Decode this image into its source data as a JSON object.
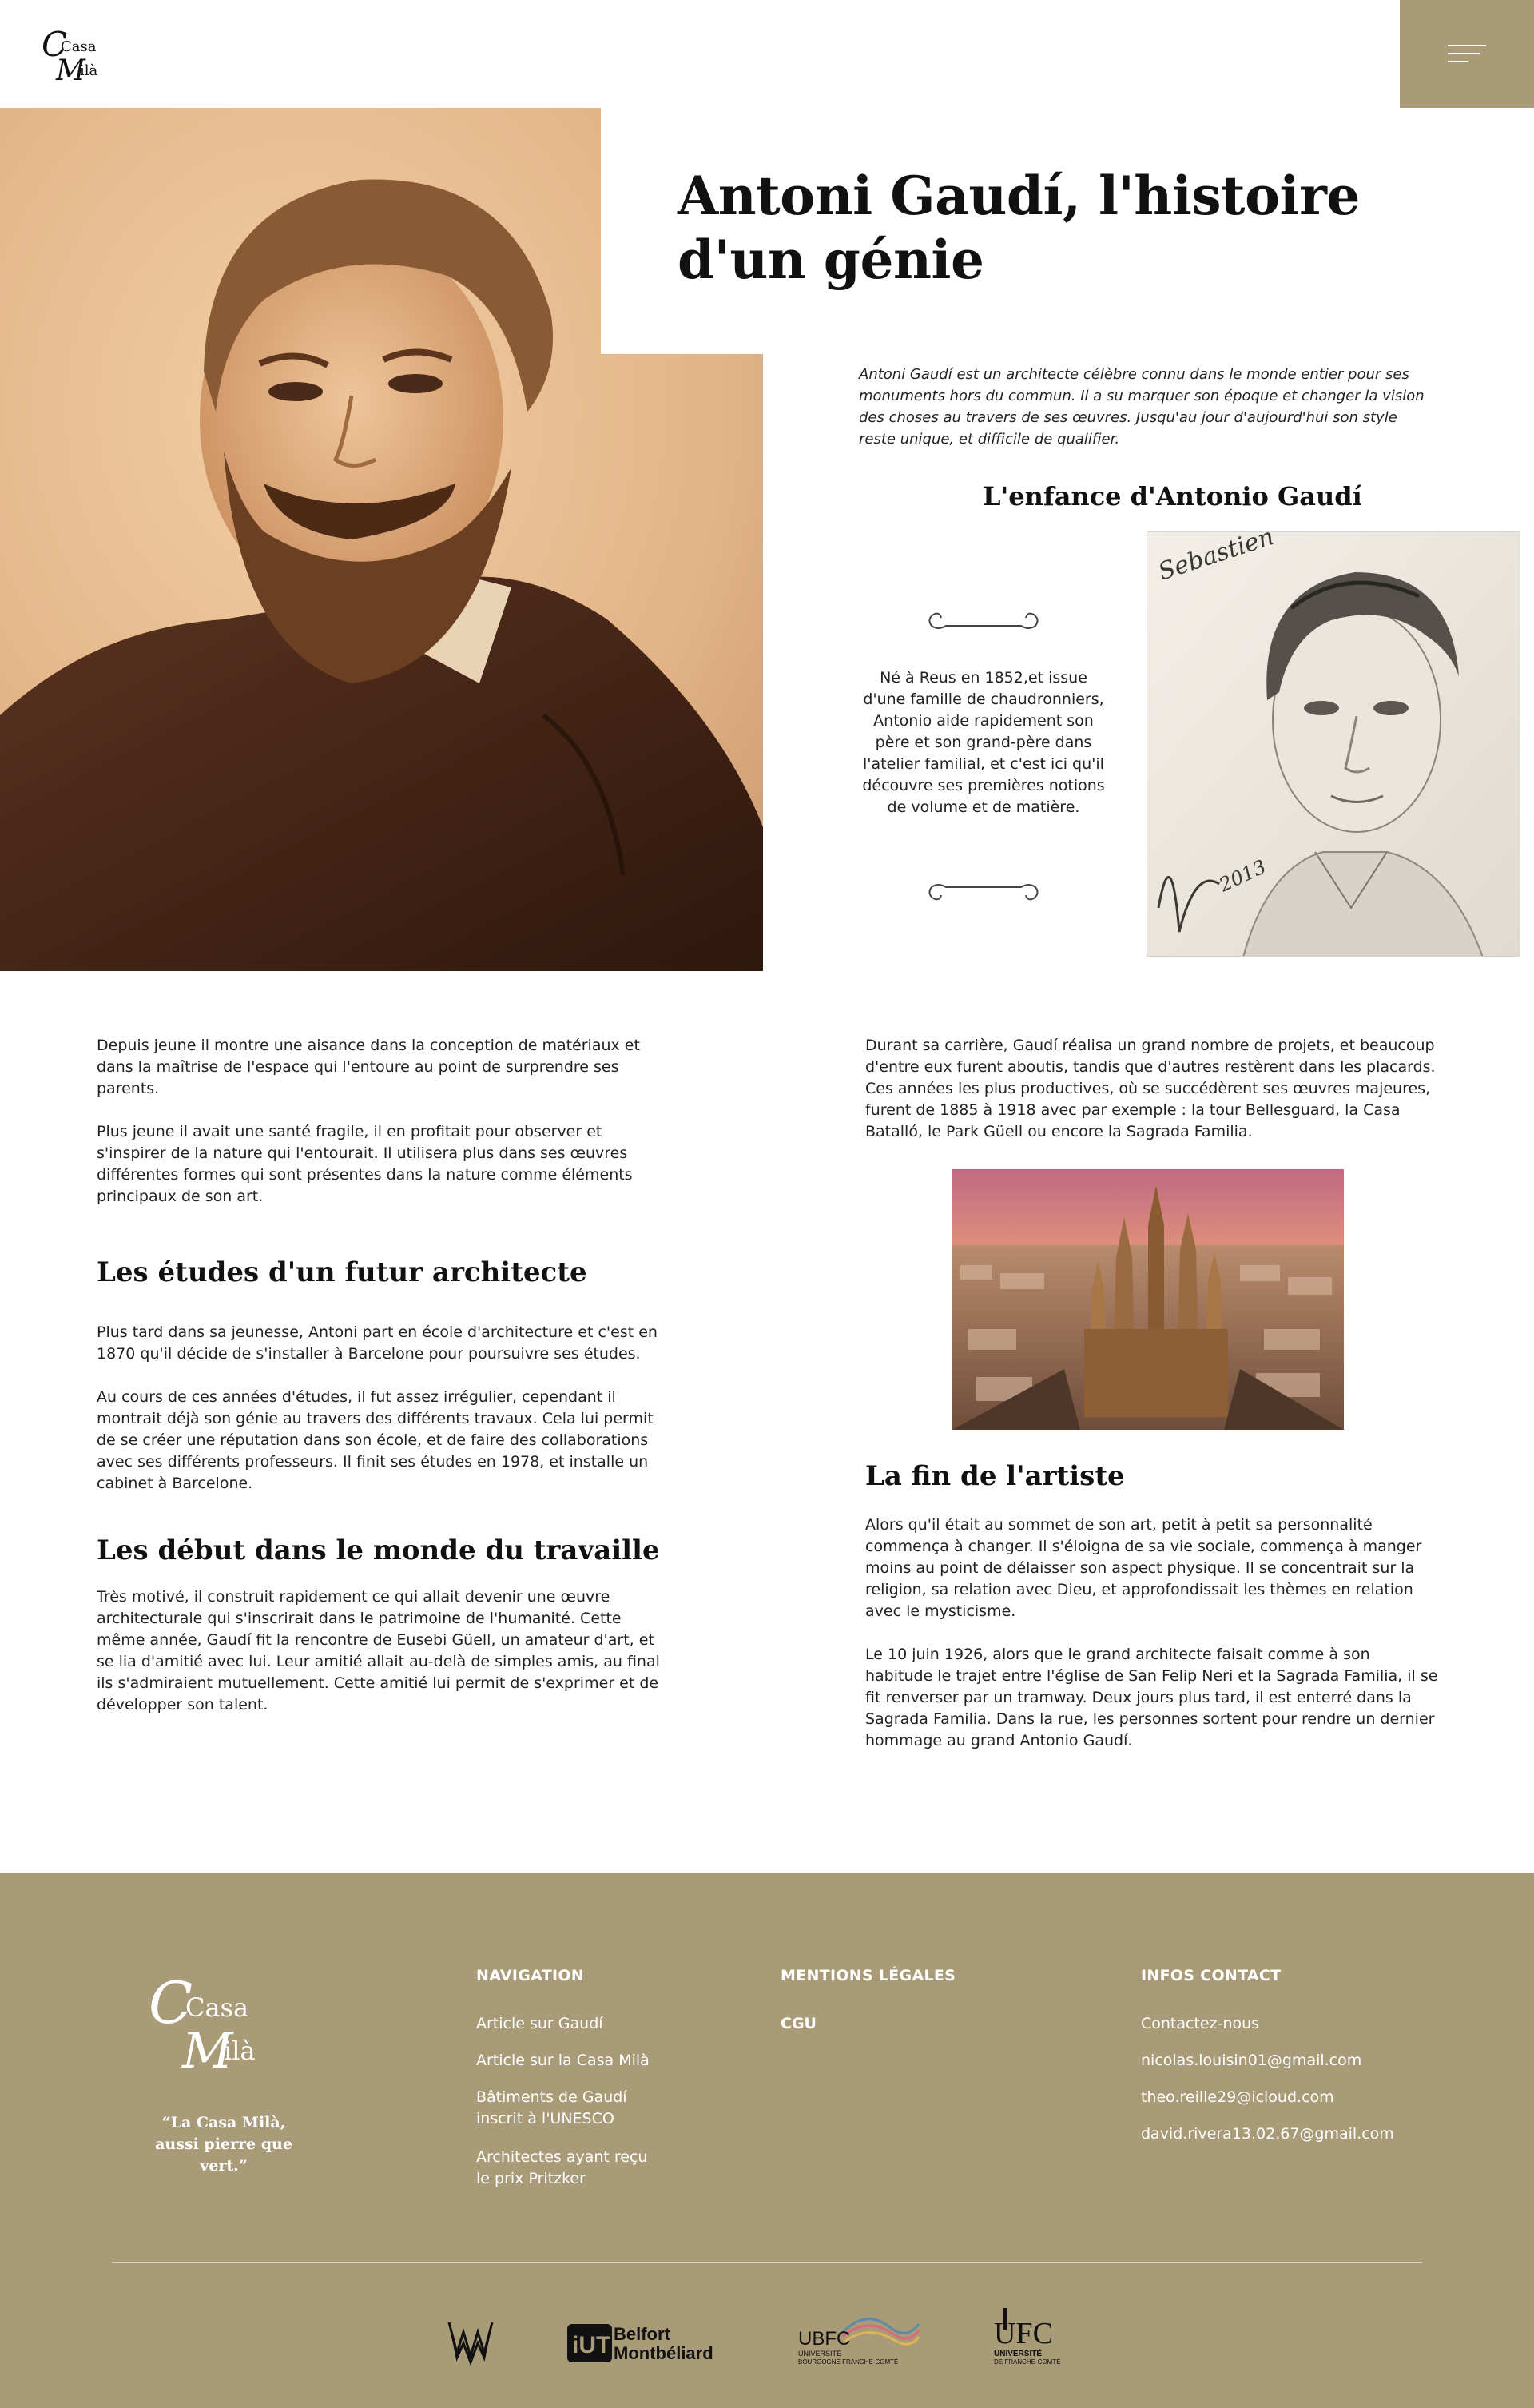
{
  "header": {
    "logo_line1": "Casa",
    "logo_line2": "Milà"
  },
  "article": {
    "title": "Antoni Gaudí, l'histoire d'un génie",
    "intro": "Antoni Gaudí est un architecte célèbre connu dans le monde entier pour ses monuments hors du commun. Il a su marquer son époque et changer la vision des choses au travers de ses œuvres. Jusqu'au jour d'aujourd'hui son style reste unique, et difficile de qualifier.",
    "childhood_title": "L'enfance d'Antonio Gaudí",
    "childhood_text": "Né à Reus en 1852,et issue d'une famille de chaudronniers, Antonio aide rapidement son père et son grand-père dans l'atelier familial, et c'est ici qu'il découvre ses premières notions de volume et de matière.",
    "sketch_signature": "Sebastien",
    "sketch_year": "2013",
    "left_p1": "  Depuis jeune il montre une aisance dans la conception de matériaux et dans la maîtrise de l'espace qui l'entoure au point de surprendre ses parents.",
    "left_p2": "Plus jeune il avait une santé fragile, il en profitait pour observer et s'inspirer de la nature qui l'entourait. Il utilisera plus dans ses œuvres différentes formes qui sont présentes dans la nature comme éléments principaux de son art.",
    "studies_title": "Les études d'un futur architecte",
    "studies_p1": "Plus tard dans sa jeunesse, Antoni part en école d'architecture et c'est en 1870 qu'il décide de s'installer à Barcelone pour poursuivre ses études.",
    "studies_p2": "Au cours de ces années d'études, il fut assez irrégulier, cependant il montrait déjà son génie au travers des différents travaux. Cela lui permit de se créer une réputation dans son école, et de faire des collaborations avec ses différents professeurs. Il finit ses études en 1978, et installe un cabinet à Barcelone.",
    "work_title": "Les début dans le monde du travaille",
    "work_p1": "Très motivé, il construit rapidement ce qui allait devenir une œuvre architecturale qui s'inscrirait dans le patrimoine de l'humanité. Cette même année, Gaudí fit la rencontre de Eusebi Güell, un amateur d'art, et se lia d'amitié avec lui. Leur amitié allait au-delà de simples amis, au final ils s'admiraient mutuellement. Cette amitié lui permit de s'exprimer et de développer son talent.",
    "career_p1": "Durant sa carrière, Gaudí réalisa un grand nombre de projets, et beaucoup d'entre eux furent aboutis, tandis que d'autres restèrent dans les placards. Ces années les plus productives, où se succédèrent ses œuvres majeures, furent de 1885 à 1918 avec par exemple : la tour Bellesguard, la Casa Batalló, le Park Güell ou encore la Sagrada Familia.",
    "end_title": "La fin de l'artiste",
    "end_p1": "Alors qu'il était au sommet de son art, petit à petit sa personnalité commença à changer. Il s'éloigna de sa vie sociale, commença à manger moins au point de délaisser son aspect physique. Il se concentrait sur la religion, sa relation avec Dieu, et approfondissait les thèmes en relation avec le mysticisme.",
    "end_p2": "  Le 10 juin 1926, alors que le grand architecte faisait comme à son habitude le trajet entre l'église de San Felip Neri et la Sagrada Familia, il se fit renverser par un tramway. Deux jours plus tard, il est enterré dans la Sagrada Familia. Dans la rue, les personnes sortent pour rendre un dernier hommage au grand Antonio Gaudí."
  },
  "footer": {
    "quote": "“La Casa Milà, aussi pierre que vert.”",
    "nav_heading": "NAVIGATION",
    "nav_links": [
      "Article sur Gaudí",
      "Article sur la Casa Milà",
      "Bâtiments de Gaudí inscrit à l'UNESCO",
      "Architectes ayant reçu le prix Pritzker"
    ],
    "legal_heading": "MENTIONS LÉGALES",
    "legal_links": [
      "CGU"
    ],
    "contact_heading": "INFOS CONTACT",
    "contact_links": [
      "Contactez-nous",
      "nicolas.louisin01@gmail.com",
      "theo.reille29@icloud.com",
      "david.rivera13.02.67@gmail.com"
    ],
    "partners": {
      "iut_line1": "Belfort",
      "iut_line2": "Montbéliard",
      "iut_mark": "iUT",
      "ubfc_name": "UBFC",
      "ubfc_sub1": "UNIVERSITÉ",
      "ubfc_sub2": "BOURGOGNE FRANCHE-COMTÉ",
      "ufc_name": "UFC",
      "ufc_sub1": "UNIVERSITÉ",
      "ufc_sub2": "DE FRANCHE-COMTÉ"
    }
  },
  "colors": {
    "accent": "#a99b78",
    "text": "#222222",
    "white": "#ffffff"
  }
}
